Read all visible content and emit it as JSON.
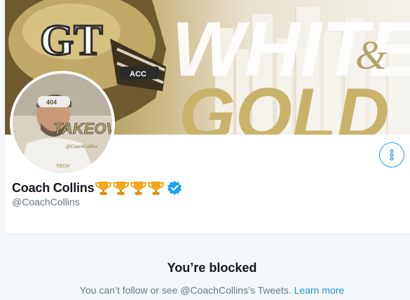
{
  "profile": {
    "display_name": "Coach Collins",
    "handle": "@CoachCollins",
    "badges": [
      "trophy-icon",
      "trophy-icon",
      "trophy-icon",
      "trophy-icon"
    ],
    "verified": true,
    "verified_icon": "verified-badge-icon",
    "more_icon": "more-vertical-icon"
  },
  "banner": {
    "helmet_logo": "GT",
    "helmet_patch": "ACC",
    "big_text": "WHITE",
    "ampersand": "&",
    "big_text_2": "GOLD"
  },
  "avatar": {
    "shirt_text": "TAKEOVER",
    "shirt_text_small": "@CoachCollins",
    "cap_text": "404",
    "logo_text": "TECH"
  },
  "blocked": {
    "title": "You’re blocked",
    "description": "You can’t follow or see @CoachCollins’s Tweets.",
    "link": "Learn more"
  },
  "colors": {
    "accent": "#1da1f2",
    "link": "#1b95e0",
    "gold": "#b3a369",
    "trophy": "#f4a61c"
  }
}
